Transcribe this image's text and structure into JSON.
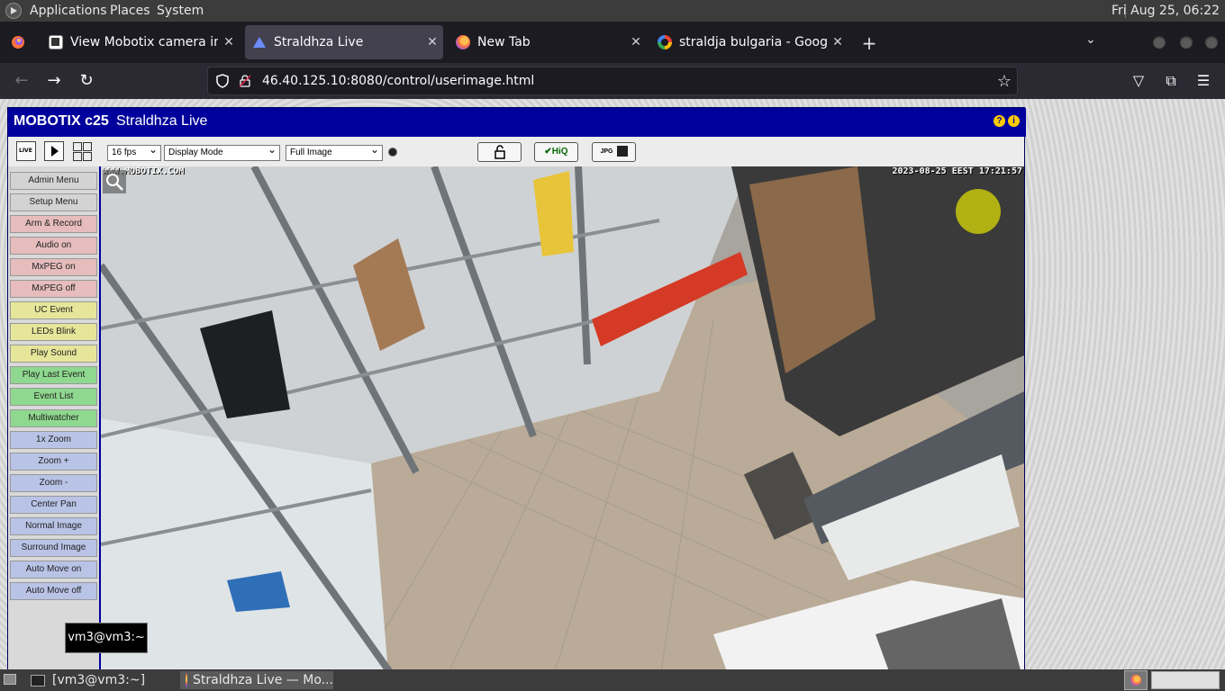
{
  "top_panel": {
    "menus": [
      "Applications",
      "Places",
      "System"
    ],
    "clock": "Fri Aug 25, 06:22"
  },
  "tabs": [
    {
      "label": "View Mobotix camera in Bul",
      "icon": "mobotix-favicon",
      "active": false
    },
    {
      "label": "Straldhza Live",
      "icon": "straldhza-favicon",
      "active": true
    },
    {
      "label": "New Tab",
      "icon": "firefox-favicon",
      "active": false
    },
    {
      "label": "straldja bulgaria - Google Se",
      "icon": "google-favicon",
      "active": false
    }
  ],
  "navbar": {
    "url": "46.40.125.10:8080/control/userimage.html"
  },
  "mobotix": {
    "brand": "MOBOTIX c25",
    "title": "Straldhza Live",
    "help_glyph": "?",
    "info_glyph": "i",
    "live_glyph": "LIVE",
    "fps": "16 fps",
    "display_mode": "Display Mode",
    "image_mode": "Full Image",
    "hiq_label": "✔HiQ",
    "jpg_label": "JPG",
    "sidebar": [
      {
        "label": "Admin Menu",
        "color": "gray"
      },
      {
        "label": "Setup Menu",
        "color": "gray"
      },
      {
        "label": "Arm & Record",
        "color": "pink"
      },
      {
        "label": "Audio on",
        "color": "pink"
      },
      {
        "label": "MxPEG on",
        "color": "pink"
      },
      {
        "label": "MxPEG off",
        "color": "pink"
      },
      {
        "label": "UC Event",
        "color": "yellow"
      },
      {
        "label": "LEDs Blink",
        "color": "yellow"
      },
      {
        "label": "Play Sound",
        "color": "yellow"
      },
      {
        "label": "Play Last Event",
        "color": "green"
      },
      {
        "label": "Event List",
        "color": "green"
      },
      {
        "label": "Multiwatcher",
        "color": "green"
      },
      {
        "label": "1x Zoom",
        "color": "blue"
      },
      {
        "label": "Zoom +",
        "color": "blue"
      },
      {
        "label": "Zoom -",
        "color": "blue"
      },
      {
        "label": "Center Pan",
        "color": "blue"
      },
      {
        "label": "Normal Image",
        "color": "blue"
      },
      {
        "label": "Surround Image",
        "color": "blue"
      },
      {
        "label": "Auto Move on",
        "color": "blue"
      },
      {
        "label": "Auto Move off",
        "color": "blue"
      }
    ],
    "camera": {
      "overlay_left": "WWW.MOBOTIX.COM",
      "timestamp": "2023-08-25 EEST 17:21:57"
    }
  },
  "tooltip": {
    "text": "vm3@vm3:~"
  },
  "taskbar": {
    "items": [
      {
        "label": "[vm3@vm3:~]",
        "active": false
      },
      {
        "label": "Straldhza Live — Mo...",
        "active": true
      }
    ]
  }
}
